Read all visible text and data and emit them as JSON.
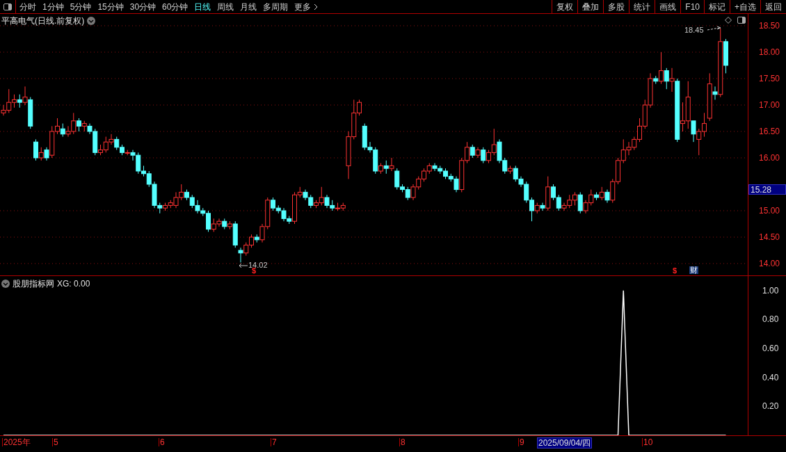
{
  "toolbar": {
    "periods": [
      {
        "label": "分时",
        "selected": false
      },
      {
        "label": "1分钟",
        "selected": false
      },
      {
        "label": "5分钟",
        "selected": false
      },
      {
        "label": "15分钟",
        "selected": false
      },
      {
        "label": "30分钟",
        "selected": false
      },
      {
        "label": "60分钟",
        "selected": false
      },
      {
        "label": "日线",
        "selected": true
      },
      {
        "label": "周线",
        "selected": false
      },
      {
        "label": "月线",
        "selected": false
      },
      {
        "label": "多周期",
        "selected": false
      },
      {
        "label": "更多",
        "selected": false
      }
    ],
    "actions": [
      "复权",
      "叠加",
      "多股",
      "统计",
      "画线",
      "F10",
      "标记",
      "+自选",
      "返回"
    ]
  },
  "chart": {
    "title": "平高电气(日线.前复权)",
    "current_price": "15.28",
    "high_label": "18.45",
    "low_label": "14.02",
    "markers": [
      {
        "text": "$",
        "kind": "dividend"
      },
      {
        "text": "$",
        "kind": "dividend"
      },
      {
        "text": "财",
        "kind": "finance"
      }
    ],
    "chart_data": {
      "type": "candlestick",
      "grid": true,
      "ylim": [
        14,
        18.5
      ],
      "yticks": [
        {
          "value": 18.5,
          "label": "18.50"
        },
        {
          "value": 18,
          "label": "18.00"
        },
        {
          "value": 17.5,
          "label": "17.50"
        },
        {
          "value": 17,
          "label": "17.00"
        },
        {
          "value": 16.5,
          "label": "16.50"
        },
        {
          "value": 16,
          "label": "16.00"
        },
        {
          "value": 15,
          "label": "15.00"
        },
        {
          "value": 14.5,
          "label": "14.50"
        },
        {
          "value": 14,
          "label": "14.00"
        }
      ],
      "ohlc": [
        [
          16.85,
          17.0,
          16.8,
          16.9
        ],
        [
          16.9,
          17.3,
          16.85,
          17.05
        ],
        [
          17.05,
          17.2,
          16.95,
          17.1
        ],
        [
          17.1,
          17.2,
          16.95,
          17.05
        ],
        [
          17.05,
          17.35,
          17.0,
          17.15
        ],
        [
          17.1,
          17.15,
          16.55,
          16.6
        ],
        [
          16.3,
          16.35,
          15.95,
          16.0
        ],
        [
          16.0,
          16.2,
          15.95,
          16.1
        ],
        [
          16.15,
          16.2,
          15.95,
          16.0
        ],
        [
          16.05,
          16.6,
          16.0,
          16.5
        ],
        [
          16.5,
          16.75,
          16.45,
          16.6
        ],
        [
          16.55,
          16.65,
          16.4,
          16.45
        ],
        [
          16.45,
          16.6,
          16.4,
          16.5
        ],
        [
          16.5,
          16.85,
          16.45,
          16.7
        ],
        [
          16.7,
          16.75,
          16.5,
          16.6
        ],
        [
          16.6,
          16.7,
          16.5,
          16.65
        ],
        [
          16.6,
          16.65,
          16.45,
          16.5
        ],
        [
          16.5,
          16.55,
          16.05,
          16.1
        ],
        [
          16.1,
          16.25,
          16.05,
          16.15
        ],
        [
          16.15,
          16.4,
          16.1,
          16.3
        ],
        [
          16.3,
          16.45,
          16.25,
          16.35
        ],
        [
          16.35,
          16.4,
          16.15,
          16.2
        ],
        [
          16.2,
          16.25,
          16.05,
          16.1
        ],
        [
          16.1,
          16.15,
          16.05,
          16.1
        ],
        [
          16.1,
          16.15,
          15.95,
          16.05
        ],
        [
          16.05,
          16.1,
          15.7,
          15.75
        ],
        [
          15.75,
          15.85,
          15.65,
          15.7
        ],
        [
          15.7,
          15.75,
          15.45,
          15.5
        ],
        [
          15.5,
          15.55,
          15.05,
          15.1
        ],
        [
          15.1,
          15.15,
          14.95,
          15.05
        ],
        [
          15.05,
          15.15,
          15.0,
          15.1
        ],
        [
          15.1,
          15.2,
          15.05,
          15.15
        ],
        [
          15.1,
          15.35,
          15.05,
          15.25
        ],
        [
          15.25,
          15.5,
          15.2,
          15.35
        ],
        [
          15.35,
          15.4,
          15.2,
          15.25
        ],
        [
          15.25,
          15.3,
          15.05,
          15.1
        ],
        [
          15.1,
          15.2,
          14.95,
          15.0
        ],
        [
          15.0,
          15.05,
          14.9,
          14.95
        ],
        [
          14.95,
          15.0,
          14.6,
          14.65
        ],
        [
          14.65,
          14.85,
          14.6,
          14.75
        ],
        [
          14.75,
          14.85,
          14.7,
          14.8
        ],
        [
          14.8,
          14.85,
          14.65,
          14.7
        ],
        [
          14.7,
          14.8,
          14.65,
          14.75
        ],
        [
          14.75,
          14.8,
          14.3,
          14.35
        ],
        [
          14.25,
          14.3,
          14.02,
          14.2
        ],
        [
          14.2,
          14.4,
          14.15,
          14.35
        ],
        [
          14.35,
          14.55,
          14.3,
          14.5
        ],
        [
          14.5,
          14.55,
          14.4,
          14.45
        ],
        [
          14.45,
          14.75,
          14.4,
          14.7
        ],
        [
          14.7,
          15.25,
          14.65,
          15.2
        ],
        [
          15.2,
          15.25,
          15.0,
          15.05
        ],
        [
          15.05,
          15.1,
          14.95,
          15.0
        ],
        [
          15.0,
          15.05,
          14.8,
          14.85
        ],
        [
          14.85,
          14.9,
          14.75,
          14.8
        ],
        [
          14.8,
          15.35,
          14.75,
          15.3
        ],
        [
          15.3,
          15.45,
          15.25,
          15.35
        ],
        [
          15.35,
          15.4,
          15.2,
          15.25
        ],
        [
          15.25,
          15.3,
          15.05,
          15.1
        ],
        [
          15.1,
          15.2,
          15.05,
          15.15
        ],
        [
          15.15,
          15.45,
          15.1,
          15.25
        ],
        [
          15.25,
          15.3,
          15.05,
          15.1
        ],
        [
          15.1,
          15.2,
          15.0,
          15.05
        ],
        [
          15.05,
          15.15,
          15.0,
          15.05
        ],
        [
          15.05,
          15.15,
          15.0,
          15.1
        ],
        [
          15.85,
          16.5,
          15.6,
          16.4
        ],
        [
          16.4,
          17.1,
          16.35,
          16.85
        ],
        [
          16.85,
          17.1,
          16.8,
          17.05
        ],
        [
          16.6,
          16.65,
          16.15,
          16.2
        ],
        [
          16.2,
          16.3,
          16.1,
          16.15
        ],
        [
          16.15,
          16.2,
          15.7,
          15.75
        ],
        [
          15.75,
          15.9,
          15.7,
          15.85
        ],
        [
          15.85,
          15.95,
          15.7,
          15.8
        ],
        [
          15.8,
          16.0,
          15.75,
          15.85
        ],
        [
          15.75,
          15.8,
          15.4,
          15.45
        ],
        [
          15.45,
          15.5,
          15.35,
          15.4
        ],
        [
          15.4,
          15.45,
          15.2,
          15.25
        ],
        [
          15.25,
          15.5,
          15.2,
          15.45
        ],
        [
          15.45,
          15.65,
          15.4,
          15.6
        ],
        [
          15.6,
          15.8,
          15.55,
          15.75
        ],
        [
          15.75,
          15.9,
          15.7,
          15.85
        ],
        [
          15.85,
          15.9,
          15.75,
          15.8
        ],
        [
          15.8,
          15.85,
          15.7,
          15.75
        ],
        [
          15.75,
          15.8,
          15.6,
          15.65
        ],
        [
          15.65,
          15.7,
          15.55,
          15.6
        ],
        [
          15.6,
          15.65,
          15.35,
          15.4
        ],
        [
          15.4,
          16.0,
          15.35,
          15.95
        ],
        [
          15.95,
          16.3,
          15.9,
          16.2
        ],
        [
          16.2,
          16.25,
          16.0,
          16.05
        ],
        [
          16.05,
          16.2,
          16.0,
          16.15
        ],
        [
          16.15,
          16.2,
          15.9,
          15.95
        ],
        [
          15.95,
          16.15,
          15.9,
          16.1
        ],
        [
          16.1,
          16.55,
          16.05,
          16.25
        ],
        [
          16.3,
          16.35,
          15.9,
          15.95
        ],
        [
          15.95,
          16.0,
          15.7,
          15.75
        ],
        [
          15.75,
          15.85,
          15.7,
          15.8
        ],
        [
          15.8,
          15.85,
          15.55,
          15.6
        ],
        [
          15.6,
          15.65,
          15.45,
          15.5
        ],
        [
          15.5,
          15.55,
          15.15,
          15.2
        ],
        [
          15.2,
          15.25,
          14.8,
          15.0
        ],
        [
          15.0,
          15.15,
          14.95,
          15.1
        ],
        [
          15.1,
          15.15,
          15.0,
          15.05
        ],
        [
          15.05,
          15.65,
          15.0,
          15.45
        ],
        [
          15.45,
          15.5,
          15.2,
          15.25
        ],
        [
          15.25,
          15.3,
          15.0,
          15.05
        ],
        [
          15.05,
          15.15,
          15.0,
          15.1
        ],
        [
          15.1,
          15.3,
          15.05,
          15.2
        ],
        [
          15.2,
          15.35,
          15.1,
          15.3
        ],
        [
          15.3,
          15.35,
          14.95,
          15.0
        ],
        [
          15.0,
          15.2,
          14.95,
          15.15
        ],
        [
          15.15,
          15.4,
          15.1,
          15.3
        ],
        [
          15.3,
          15.35,
          15.2,
          15.25
        ],
        [
          15.25,
          15.45,
          15.2,
          15.35
        ],
        [
          15.35,
          15.4,
          15.15,
          15.2
        ],
        [
          15.2,
          15.6,
          15.15,
          15.55
        ],
        [
          15.55,
          16.0,
          15.5,
          15.95
        ],
        [
          15.95,
          16.35,
          15.9,
          16.15
        ],
        [
          16.15,
          16.3,
          16.05,
          16.2
        ],
        [
          16.2,
          16.4,
          16.15,
          16.35
        ],
        [
          16.35,
          16.75,
          16.3,
          16.6
        ],
        [
          16.6,
          17.1,
          16.55,
          17.0
        ],
        [
          17.0,
          17.6,
          16.95,
          17.5
        ],
        [
          17.5,
          17.55,
          17.4,
          17.45
        ],
        [
          17.45,
          18.0,
          17.4,
          17.65
        ],
        [
          17.65,
          17.7,
          17.3,
          17.45
        ],
        [
          17.45,
          17.7,
          17.25,
          17.5
        ],
        [
          17.45,
          17.5,
          16.3,
          16.35
        ],
        [
          16.65,
          17.05,
          16.5,
          16.7
        ],
        [
          16.7,
          17.45,
          16.55,
          17.15
        ],
        [
          16.7,
          16.7,
          16.3,
          16.45
        ],
        [
          16.35,
          16.55,
          16.05,
          16.5
        ],
        [
          16.5,
          16.85,
          16.4,
          16.65
        ],
        [
          16.75,
          17.6,
          16.7,
          17.4
        ],
        [
          17.25,
          17.35,
          17.1,
          17.2
        ],
        [
          17.2,
          18.45,
          17.15,
          18.2
        ],
        [
          18.2,
          18.25,
          17.6,
          17.75
        ]
      ]
    }
  },
  "indicator": {
    "name": "股朋指标网",
    "separator": ":",
    "value": "0.00",
    "chart_data": {
      "type": "line",
      "ylim": [
        0,
        1.1
      ],
      "yticks": [
        {
          "value": 1,
          "label": "1.00"
        },
        {
          "value": 0.8,
          "label": "0.80"
        },
        {
          "value": 0.6,
          "label": "0.60"
        },
        {
          "value": 0.4,
          "label": "0.40"
        },
        {
          "value": 0.2,
          "label": "0.20"
        }
      ],
      "series": [
        {
          "name": "XG",
          "color": "#ffffff",
          "values": [
            0,
            0,
            0,
            0,
            0,
            0,
            0,
            0,
            0,
            0,
            0,
            0,
            0,
            0,
            0,
            0,
            0,
            0,
            0,
            0,
            0,
            0,
            0,
            0,
            0,
            0,
            0,
            0,
            0,
            0,
            0,
            0,
            0,
            0,
            0,
            0,
            0,
            0,
            0,
            0,
            0,
            0,
            0,
            0,
            0,
            0,
            0,
            0,
            0,
            0,
            0,
            0,
            0,
            0,
            0,
            0,
            0,
            0,
            0,
            0,
            0,
            0,
            0,
            0,
            0,
            0,
            0,
            0,
            0,
            0,
            0,
            0,
            0,
            0,
            0,
            0,
            0,
            0,
            0,
            0,
            0,
            0,
            0,
            0,
            0,
            0,
            0,
            0,
            0,
            0,
            0,
            0,
            0,
            0,
            0,
            0,
            0,
            0,
            0,
            0,
            0,
            0,
            0,
            0,
            0,
            0,
            0,
            0,
            0,
            0,
            0,
            0,
            0,
            0,
            0,
            1,
            0,
            0,
            0,
            0,
            0,
            0,
            0,
            0,
            0,
            0,
            0,
            0,
            0,
            0,
            0,
            0,
            0,
            0,
            0
          ]
        }
      ]
    }
  },
  "x_axis": {
    "labels": [
      "2025年",
      "5",
      "6",
      "7",
      "8",
      "9",
      "10"
    ],
    "cursor_date": "2025/09/04/四"
  }
}
